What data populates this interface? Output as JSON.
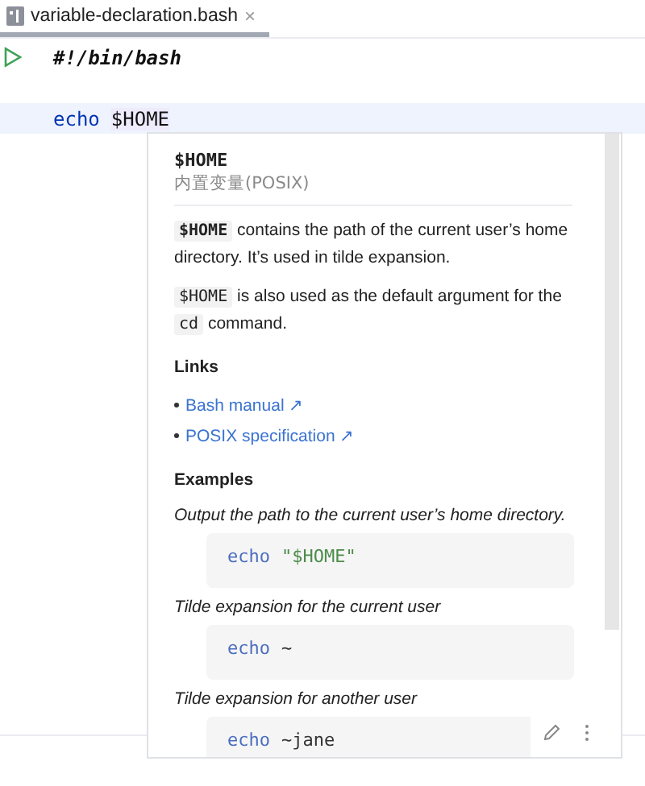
{
  "tab": {
    "label": "variable-declaration.bash",
    "close": "×",
    "selected": true
  },
  "editor": {
    "lines": [
      {
        "tokens": [
          {
            "kind": "shebang",
            "text": "#!/bin/bash"
          }
        ],
        "run": true,
        "current": false
      },
      {
        "run": false,
        "current": false
      },
      {
        "tokens": [
          {
            "kind": "keyword",
            "text": "echo"
          },
          {
            "kind": "variable",
            "text": "$HOME"
          }
        ],
        "run": false,
        "current": true
      }
    ]
  },
  "popup": {
    "title": "$HOME",
    "subtitle": "内置变量(POSIX)",
    "paragraphs": [
      [
        {
          "code": true,
          "strong": true,
          "text": "$HOME"
        },
        {
          "code": false,
          "text": "contains the path of the current user’s home directory. It’s used in tilde expansion."
        }
      ],
      [
        {
          "code": true,
          "strong": false,
          "text": "$HOME"
        },
        {
          "code": false,
          "text": "is also used as the default argument for the"
        },
        {
          "code": true,
          "strong": false,
          "text": "cd"
        },
        {
          "code": false,
          "text": "command."
        }
      ]
    ],
    "links_heading": "Links",
    "links": [
      {
        "text": "Bash manual",
        "arrow": "↗"
      },
      {
        "text": "POSIX specification",
        "arrow": "↗"
      }
    ],
    "examples_heading": "Examples",
    "examples": [
      {
        "description": "Output the path to the current user’s home directory.",
        "tokens": [
          {
            "kind": "keyword",
            "text": "echo"
          },
          {
            "kind": "string",
            "text": "\"$HOME\""
          }
        ]
      },
      {
        "description": "Tilde expansion for the current user",
        "tokens": [
          {
            "kind": "keyword",
            "text": "echo"
          },
          {
            "kind": "plain",
            "text": "~"
          }
        ]
      },
      {
        "description": "Tilde expansion for another user",
        "tokens": [
          {
            "kind": "keyword",
            "text": "echo"
          },
          {
            "kind": "plain",
            "text": "~jane"
          }
        ]
      }
    ]
  }
}
